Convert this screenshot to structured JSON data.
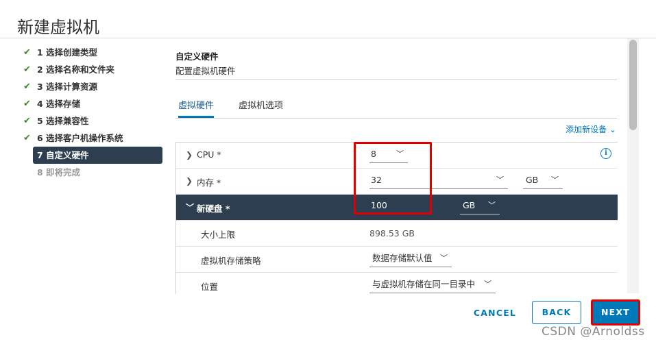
{
  "dialog": {
    "title": "新建虚拟机"
  },
  "steps": [
    {
      "label": "1 选择创建类型",
      "status": "done"
    },
    {
      "label": "2 选择名称和文件夹",
      "status": "done"
    },
    {
      "label": "3 选择计算资源",
      "status": "done"
    },
    {
      "label": "4 选择存储",
      "status": "done"
    },
    {
      "label": "5 选择兼容性",
      "status": "done"
    },
    {
      "label": "6 选择客户机操作系统",
      "status": "done"
    },
    {
      "label": "7 自定义硬件",
      "status": "active"
    },
    {
      "label": "8 即将完成",
      "status": "pending"
    }
  ],
  "section": {
    "title": "自定义硬件",
    "subtitle": "配置虚拟机硬件"
  },
  "tabs": [
    {
      "label": "虚拟硬件"
    },
    {
      "label": "虚拟机选项"
    }
  ],
  "add_device": "添加新设备 ⌄",
  "hardware": {
    "cpu": {
      "label": "CPU *",
      "value": "8"
    },
    "memory": {
      "label": "内存 *",
      "value": "32",
      "unit": "GB"
    },
    "disk": {
      "label": "新硬盘 *",
      "value": "100",
      "unit": "GB",
      "max_label": "大小上限",
      "max_value": "898.53 GB",
      "policy_label": "虚拟机存储策略",
      "policy_value": "数据存储默认值",
      "location_label": "位置",
      "location_value": "与虚拟机存储在同一目录中"
    }
  },
  "footer": {
    "cancel": "CANCEL",
    "back": "BACK",
    "next": "NEXT"
  },
  "watermark": "CSDN @Arnoldss",
  "colors": {
    "accent": "#0079b8",
    "header_bg": "#2c3e4f",
    "check": "#3a8a2b",
    "highlight": "#e00000"
  }
}
